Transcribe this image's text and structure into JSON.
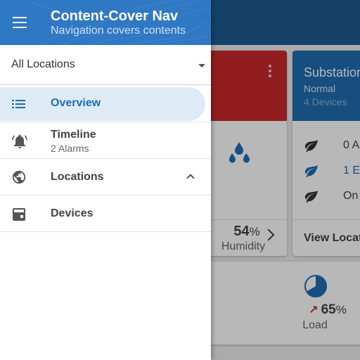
{
  "background": {
    "humidity": {
      "value": "54",
      "unit": "%",
      "label": "Humidity"
    },
    "substation": {
      "title": "Substation",
      "status": "Normal",
      "devices": "4 Devices",
      "rows": [
        {
          "text": "0 A",
          "color": "#424242"
        },
        {
          "text": "1 E",
          "color": "#1f6cb2"
        },
        {
          "text": "On",
          "color": "#424242"
        }
      ],
      "action": "View Locat"
    },
    "load": {
      "value": "65",
      "unit": "%",
      "label": "Load"
    }
  },
  "drawer": {
    "title": "Content-Cover Nav",
    "subtitle": "Navigation covers contents",
    "location_select": {
      "value": "All Locations"
    },
    "items": [
      {
        "label": "Overview",
        "icon": "list-icon",
        "active": true
      },
      {
        "label": "Timeline",
        "sublabel": "2 Alarms",
        "icon": "alarm-bell-icon"
      },
      {
        "label": "Locations",
        "icon": "globe-icon",
        "expanded": true
      },
      {
        "label": "Devices",
        "icon": "device-icon"
      }
    ]
  },
  "colors": {
    "primary": "#1f6cb2",
    "header": "#2f78c4",
    "alarm": "#c9292b",
    "active_bg": "#deebf6"
  }
}
